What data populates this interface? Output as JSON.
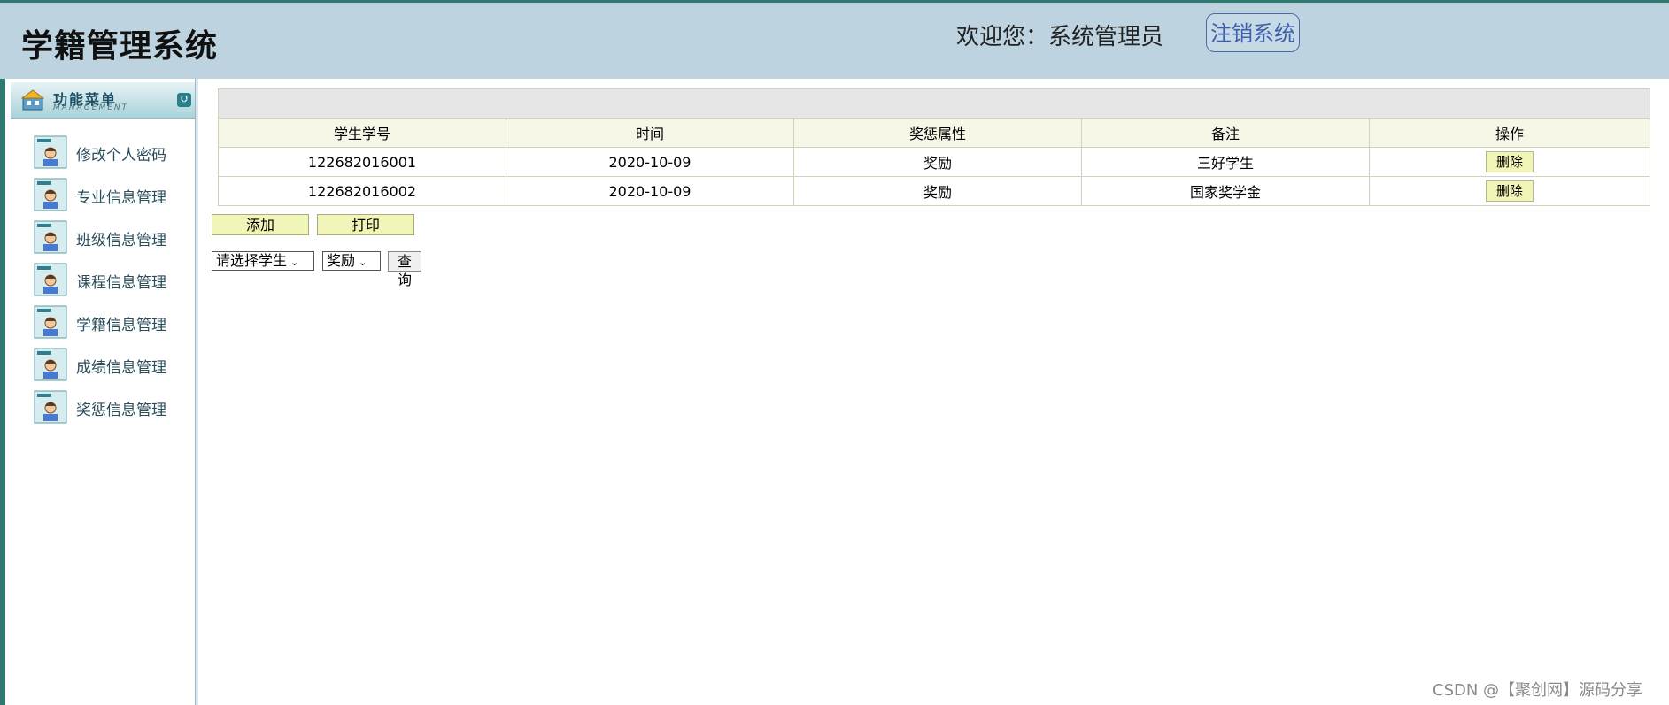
{
  "header": {
    "title": "学籍管理系统",
    "welcome": "欢迎您：系统管理员",
    "logout_label": "注销系统"
  },
  "sidebar": {
    "menu_title": "功能菜单",
    "menu_subtitle": "MANAGEMENT",
    "items": [
      {
        "label": "修改个人密码",
        "icon": "student-card-icon"
      },
      {
        "label": "专业信息管理",
        "icon": "student-card-icon"
      },
      {
        "label": "班级信息管理",
        "icon": "student-card-icon"
      },
      {
        "label": "课程信息管理",
        "icon": "student-card-icon"
      },
      {
        "label": "学籍信息管理",
        "icon": "student-card-icon"
      },
      {
        "label": "成绩信息管理",
        "icon": "student-card-icon"
      },
      {
        "label": "奖惩信息管理",
        "icon": "student-card-icon"
      }
    ]
  },
  "table": {
    "headers": [
      "学生学号",
      "时间",
      "奖惩属性",
      "备注",
      "操作"
    ],
    "rows": [
      {
        "student_id": "122682016001",
        "date": "2020-10-09",
        "type": "奖励",
        "note": "三好学生",
        "action": "删除"
      },
      {
        "student_id": "122682016002",
        "date": "2020-10-09",
        "type": "奖励",
        "note": "国家奖学金",
        "action": "删除"
      }
    ]
  },
  "actions": {
    "add_label": "添加",
    "print_label": "打印"
  },
  "filter": {
    "student_select": "请选择学生",
    "type_select": "奖励",
    "query_label": "查询"
  },
  "watermark": "CSDN @【聚创网】源码分享",
  "colors": {
    "header_bg": "#bdd4e0",
    "accent_green": "#2e7a6e",
    "button_yellow": "#f2f5b8",
    "table_header_bg": "#f7f7e8"
  }
}
